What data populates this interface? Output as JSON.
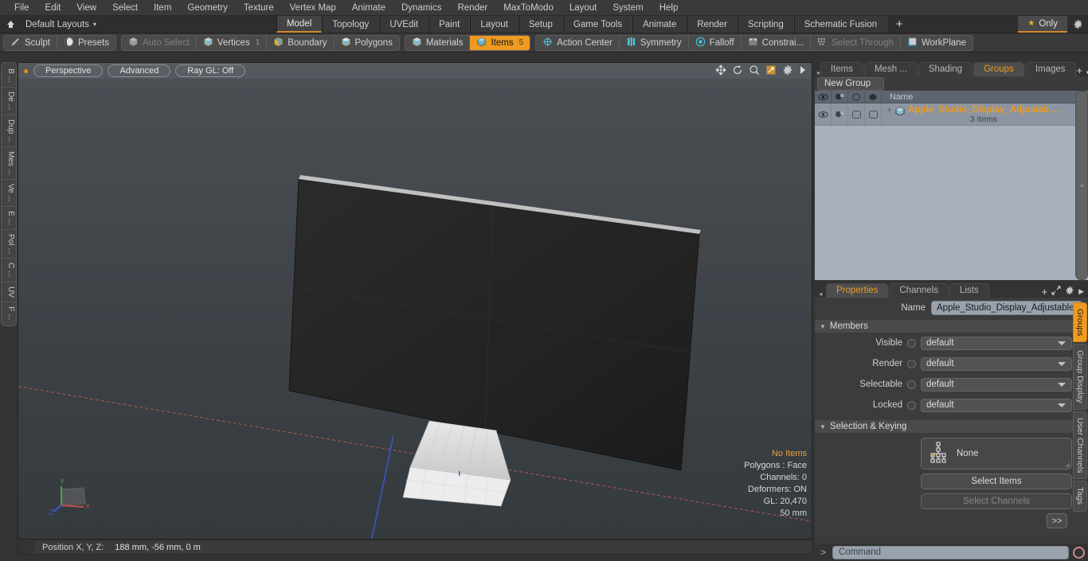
{
  "menubar": {
    "items": [
      "File",
      "Edit",
      "View",
      "Select",
      "Item",
      "Geometry",
      "Texture",
      "Vertex Map",
      "Animate",
      "Dynamics",
      "Render",
      "MaxToModo",
      "Layout",
      "System",
      "Help"
    ]
  },
  "layoutbar": {
    "home_icon": "home-icon",
    "default_layouts": "Default Layouts",
    "dropdown_caret": "▾",
    "tabs": [
      {
        "label": "Model",
        "active": true
      },
      {
        "label": "Topology",
        "active": false
      },
      {
        "label": "UVEdit",
        "active": false
      },
      {
        "label": "Paint",
        "active": false
      },
      {
        "label": "Layout",
        "active": false
      },
      {
        "label": "Setup",
        "active": false
      },
      {
        "label": "Game Tools",
        "active": false
      },
      {
        "label": "Animate",
        "active": false
      },
      {
        "label": "Render",
        "active": false
      },
      {
        "label": "Scripting",
        "active": false
      },
      {
        "label": "Schematic Fusion",
        "active": false
      }
    ],
    "add_tab": "+",
    "only_label": "Only",
    "only_icon": "star-icon",
    "gear_icon": "gear-icon"
  },
  "toolbar": {
    "group1": [
      {
        "label": "Sculpt",
        "icon": "brush-icon",
        "state": "normal"
      },
      {
        "label": "Presets",
        "icon": "sphere-icon",
        "state": "normal"
      }
    ],
    "group2": [
      {
        "label": "Auto Select",
        "icon": "cube-grey-icon",
        "state": "disabled",
        "count": ""
      },
      {
        "label": "Vertices",
        "icon": "cube-vertex-icon",
        "state": "normal",
        "count": "1"
      },
      {
        "label": "Boundary",
        "icon": "cube-boundary-icon",
        "state": "normal",
        "count": ""
      },
      {
        "label": "Polygons",
        "icon": "cube-polygon-icon",
        "state": "normal",
        "count": ""
      }
    ],
    "group3": [
      {
        "label": "Materials",
        "icon": "cube-material-icon",
        "state": "normal",
        "count": ""
      },
      {
        "label": "Items",
        "icon": "cube-items-icon",
        "state": "selected",
        "count": "5"
      }
    ],
    "group4": [
      {
        "label": "Action Center",
        "icon": "crosshair-icon",
        "state": "normal"
      },
      {
        "label": "Symmetry",
        "icon": "symmetry-icon",
        "state": "normal"
      },
      {
        "label": "Falloff",
        "icon": "target-icon",
        "state": "normal"
      },
      {
        "label": "Constrai...",
        "icon": "constraint-icon",
        "state": "normal"
      },
      {
        "label": "Select Through",
        "icon": "select-through-icon",
        "state": "disabled"
      },
      {
        "label": "WorkPlane",
        "icon": "workplane-icon",
        "state": "normal"
      }
    ]
  },
  "left_vtabs": [
    "B ...",
    "De ...",
    "Dup ...",
    "Mes ...",
    "Ve ...",
    "E ...",
    "Pol ...",
    "C ...",
    "UV",
    "F ..."
  ],
  "viewport": {
    "view_mode": "Perspective",
    "shading_mode": "Advanced",
    "raygl": "Ray GL: Off",
    "nav_icons": [
      "move-icon",
      "rotate-icon",
      "zoom-icon",
      "fit-icon",
      "gear-icon",
      "arrow-right-icon"
    ],
    "stats": {
      "selection": "No Items",
      "polygons": "Polygons : Face",
      "channels": "Channels: 0",
      "deformers": "Deformers: ON",
      "gl": "GL: 20,470",
      "grid": "50 mm"
    },
    "gizmo": {
      "x": "X",
      "y": "Y",
      "z": "Z"
    }
  },
  "position_bar": {
    "label": "Position X, Y, Z:",
    "value": "188 mm, -56 mm, 0 m"
  },
  "right_panel": {
    "top_tabs": [
      {
        "label": "Items",
        "active": false
      },
      {
        "label": "Mesh ...",
        "active": false
      },
      {
        "label": "Shading",
        "active": false
      },
      {
        "label": "Groups",
        "active": true
      },
      {
        "label": "Images",
        "active": false
      }
    ],
    "add_tab": "+",
    "new_group_button": "New Group",
    "tree": {
      "columns": [
        "eye-icon",
        "render-icon",
        "cube-outline-icon",
        "cube-solid-icon"
      ],
      "name_header": "Name",
      "rows": [
        {
          "expand": "+",
          "icon": "mesh-group-icon",
          "title": "Apple_Studio_Display_Adjustab ...",
          "subtitle": "3 Items"
        }
      ]
    },
    "properties": {
      "tabs": [
        {
          "label": "Properties",
          "active": true
        },
        {
          "label": "Channels",
          "active": false
        },
        {
          "label": "Lists",
          "active": false
        }
      ],
      "add_tab": "+",
      "name_label": "Name",
      "name_value": "Apple_Studio_Display_Adjustable_Sta",
      "members_section": "Members",
      "members_rows": [
        {
          "label": "Visible",
          "value": "default"
        },
        {
          "label": "Render",
          "value": "default"
        },
        {
          "label": "Selectable",
          "value": "default"
        },
        {
          "label": "Locked",
          "value": "default"
        }
      ],
      "selection_section": "Selection & Keying",
      "selection_none": "None",
      "select_items_button": "Select Items",
      "select_channels_button": "Select Channels",
      "forward_button": ">>"
    },
    "right_vtabs": [
      {
        "label": "Groups",
        "active": true
      },
      {
        "label": "Group Display",
        "active": false
      },
      {
        "label": "User Channels",
        "active": false
      },
      {
        "label": "Tags",
        "active": false
      }
    ]
  },
  "command_bar": {
    "prompt": ">",
    "placeholder": "Command",
    "record_icon": "record-icon"
  },
  "colors": {
    "accent_orange": "#ee9b22",
    "panel_bg": "#333333",
    "toolbar_bg": "#3a3a3a",
    "list_bg": "#a8b0bb",
    "axis_x": "#b05050",
    "axis_z": "#4057c8",
    "axis_y": "#4c9a4c"
  }
}
